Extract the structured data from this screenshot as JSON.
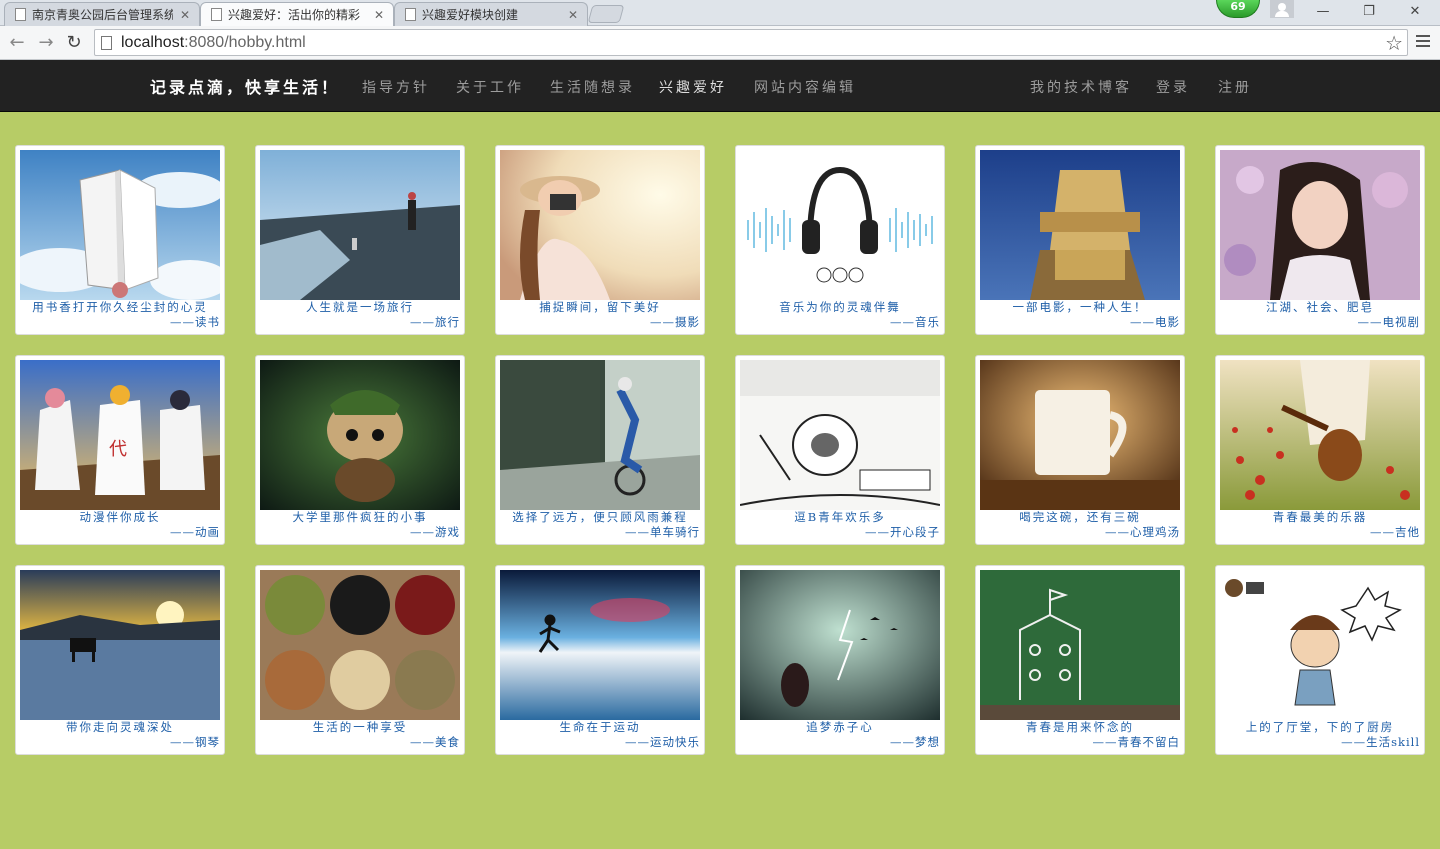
{
  "browser": {
    "tabs": [
      {
        "label": "南京青奥公园后台管理系统",
        "active": false
      },
      {
        "label": "兴趣爱好：活出你的精彩",
        "active": true
      },
      {
        "label": "兴趣爱好模块创建",
        "active": false
      }
    ],
    "badge_count": "69",
    "url_host": "localhost",
    "url_rest": ":8080/hobby.html"
  },
  "navbar": {
    "brand": "记录点滴，快享生活！",
    "left_items": [
      "指导方针",
      "关于工作",
      "生活随想录",
      "兴趣爱好",
      "网站内容编辑"
    ],
    "right_items": [
      "我的技术博客",
      "登录",
      "注册"
    ]
  },
  "hobbies": [
    {
      "caption": "用书香打开你久经尘封的心灵",
      "category": "——读书",
      "image": "open-book-sky"
    },
    {
      "caption": "人生就是一场旅行",
      "category": "——旅行",
      "image": "beach-traveler"
    },
    {
      "caption": "捕捉瞬间，留下美好",
      "category": "——摄影",
      "image": "girl-camera-sunlight"
    },
    {
      "caption": "音乐为你的灵魂伴舞",
      "category": "——音乐",
      "image": "headphones-soundwave"
    },
    {
      "caption": "一部电影，一种人生！",
      "category": "——电影",
      "image": "20th-century-fox-logo"
    },
    {
      "caption": "江湖、社会、肥皂",
      "category": "——电视剧",
      "image": "smiling-actress-flowers"
    },
    {
      "caption": "动漫伴你成长",
      "category": "——动画",
      "image": "anime-hokage-trio"
    },
    {
      "caption": "大学里那件疯狂的小事",
      "category": "——游戏",
      "image": "game-teemo-character"
    },
    {
      "caption": "选择了远方，便只顾风雨兼程",
      "category": "——单车骑行",
      "image": "cyclist-road"
    },
    {
      "caption": "逗B青年欢乐多",
      "category": "——开心段子",
      "image": "meme-scholar-comic"
    },
    {
      "caption": "喝完这碗，还有三碗",
      "category": "——心理鸡汤",
      "image": "coffee-cup-warm"
    },
    {
      "caption": "青春最美的乐器",
      "category": "——吉他",
      "image": "guitar-poppy-field"
    },
    {
      "caption": "带你走向灵魂深处",
      "category": "——钢琴",
      "image": "piano-on-water-sunset"
    },
    {
      "caption": "生活的一种享受",
      "category": "——美食",
      "image": "grains-beans-bowls"
    },
    {
      "caption": "生命在于运动",
      "category": "——运动快乐",
      "image": "runner-sunset-reflection"
    },
    {
      "caption": "追梦赤子心",
      "category": "——梦想",
      "image": "dream-storm-birds"
    },
    {
      "caption": "青春是用来怀念的",
      "category": "——青春不留白",
      "image": "chalkboard-youth"
    },
    {
      "caption": "上的了厅堂，下的了厨房",
      "category": "——生活skill",
      "image": "cartoon-boy-skill"
    }
  ]
}
